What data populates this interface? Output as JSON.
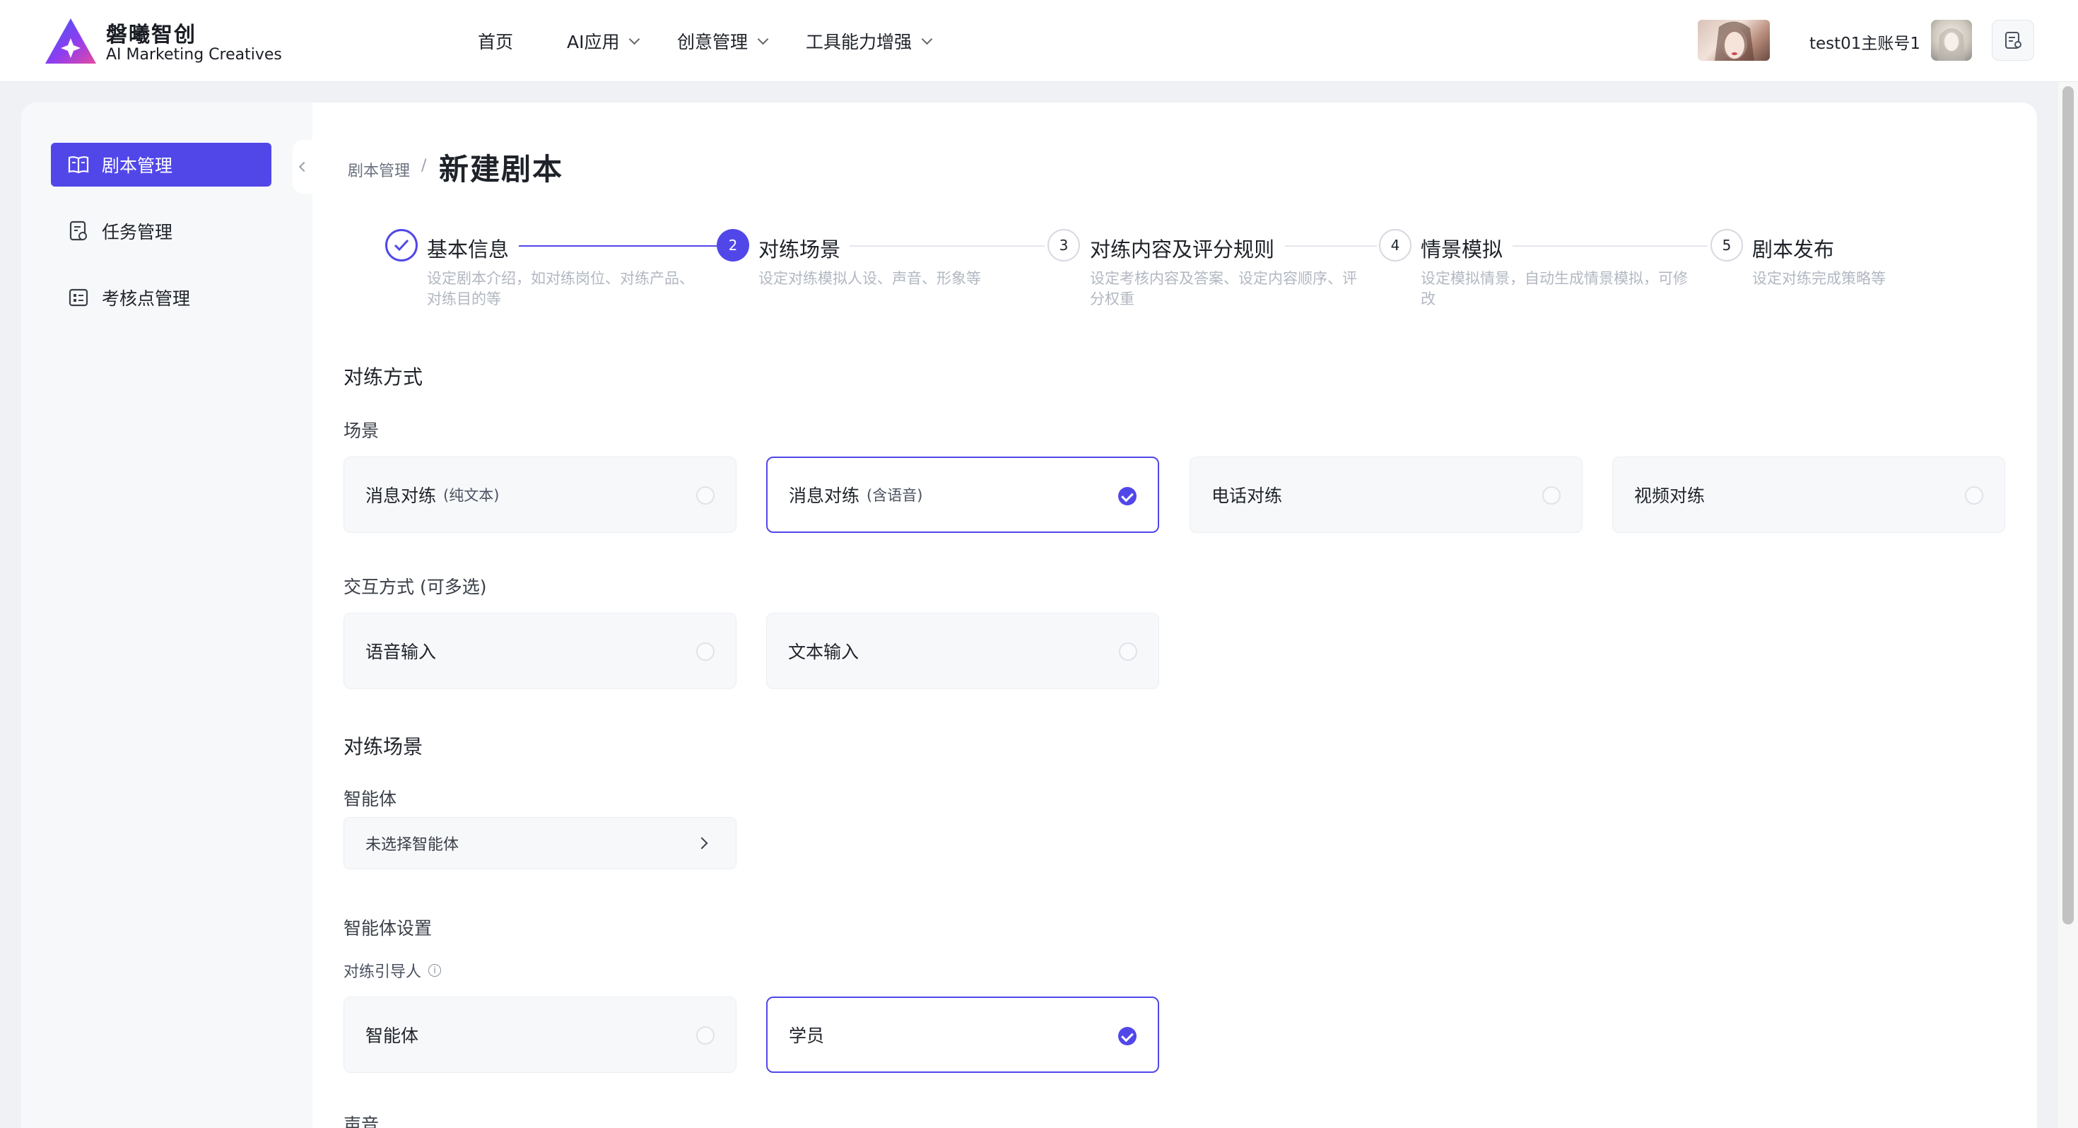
{
  "brand": {
    "name": "磐曦智创",
    "subtitle": "AI Marketing Creatives",
    "colors": {
      "primary": "#5147e9",
      "logo_gradient": [
        "#3b5bf6",
        "#8e3df0",
        "#e64aa0"
      ]
    }
  },
  "nav": {
    "home": "首页",
    "ai_apps": "AI应用",
    "creative": "创意管理",
    "tools": "工具能力增强"
  },
  "user": {
    "name": "test01主账号1",
    "icons": [
      "gallery-thumbnail",
      "avatar",
      "notes-icon"
    ]
  },
  "sidebar": {
    "items": [
      {
        "label": "剧本管理",
        "icon": "book-icon",
        "active": true
      },
      {
        "label": "任务管理",
        "icon": "task-icon",
        "active": false
      },
      {
        "label": "考核点管理",
        "icon": "checklist-icon",
        "active": false
      }
    ]
  },
  "breadcrumb": {
    "parent": "剧本管理",
    "separator": "/",
    "current": "新建剧本"
  },
  "steps": [
    {
      "index": "1",
      "title": "基本信息",
      "desc": "设定剧本介绍，如对练岗位、对练产品、对练目的等",
      "status": "done"
    },
    {
      "index": "2",
      "title": "对练场景",
      "desc": "设定对练模拟人设、声音、形象等",
      "status": "active"
    },
    {
      "index": "3",
      "title": "对练内容及评分规则",
      "desc": "设定考核内容及答案、设定内容顺序、评分权重",
      "status": "todo"
    },
    {
      "index": "4",
      "title": "情景模拟",
      "desc": "设定模拟情景，自动生成情景模拟，可修改",
      "status": "todo"
    },
    {
      "index": "5",
      "title": "剧本发布",
      "desc": "设定对练完成策略等",
      "status": "todo"
    }
  ],
  "form": {
    "practice_mode_title": "对练方式",
    "scene_label": "场景",
    "scene_options": [
      {
        "label": "消息对练",
        "sub": "(纯文本)",
        "selected": false
      },
      {
        "label": "消息对练",
        "sub": "(含语音)",
        "selected": true
      },
      {
        "label": "电话对练",
        "sub": "",
        "selected": false
      },
      {
        "label": "视频对练",
        "sub": "",
        "selected": false
      }
    ],
    "interaction_label": "交互方式 (可多选)",
    "interaction_options": [
      {
        "label": "语音输入",
        "selected": false
      },
      {
        "label": "文本输入",
        "selected": false
      }
    ],
    "practice_scene_title": "对练场景",
    "agent_label": "智能体",
    "agent_placeholder": "未选择智能体",
    "agent_settings_title": "智能体设置",
    "guide_label": "对练引导人",
    "guide_info_icon": "info-icon",
    "guide_options": [
      {
        "label": "智能体",
        "selected": false
      },
      {
        "label": "学员",
        "selected": true
      }
    ],
    "voice_label": "声音"
  }
}
